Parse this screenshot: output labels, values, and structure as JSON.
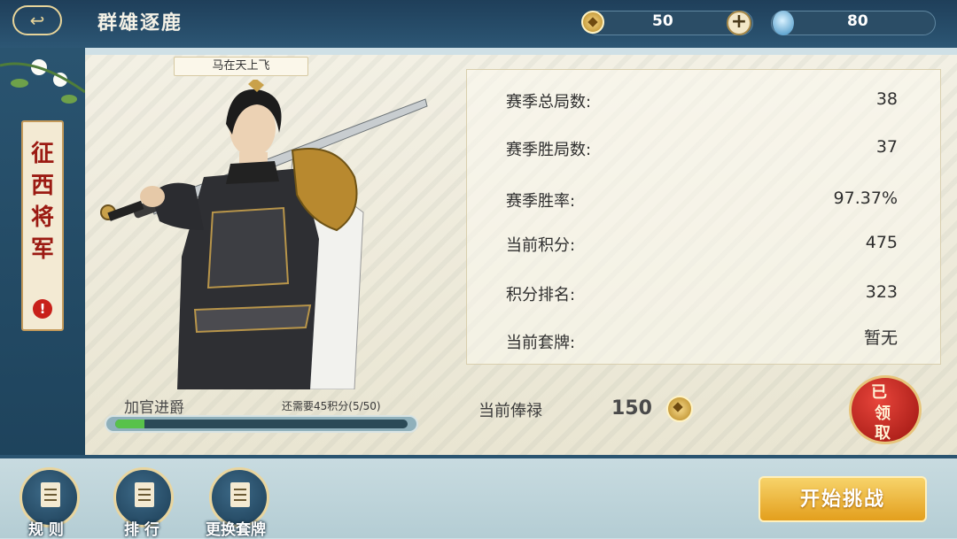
{
  "header": {
    "title": "群雄逐鹿",
    "coins": "50",
    "jade": "80"
  },
  "rank": {
    "title_chars": [
      "征",
      "西",
      "将",
      "军"
    ],
    "alert": "!"
  },
  "player": {
    "name": "马在天上飞"
  },
  "stats": [
    {
      "label": "赛季总局数:",
      "value": "38"
    },
    {
      "label": "赛季胜局数:",
      "value": "37"
    },
    {
      "label": "赛季胜率:",
      "value": "97.37%"
    },
    {
      "label": "当前积分:",
      "value": "475"
    },
    {
      "label": "积分排名:",
      "value": "323"
    },
    {
      "label": "当前套牌:",
      "value": "暂无"
    }
  ],
  "promotion": {
    "label": "加官进爵",
    "need_text": "还需要45积分(5/50)",
    "progress": 0.1
  },
  "salary": {
    "label": "当前俸禄",
    "value": "150"
  },
  "claimed": {
    "c1": "已",
    "c2": "领",
    "c3": "取"
  },
  "bottom": {
    "rules": "规 则",
    "ranking": "排 行",
    "change_deck": "更换套牌",
    "start": "开始挑战"
  }
}
